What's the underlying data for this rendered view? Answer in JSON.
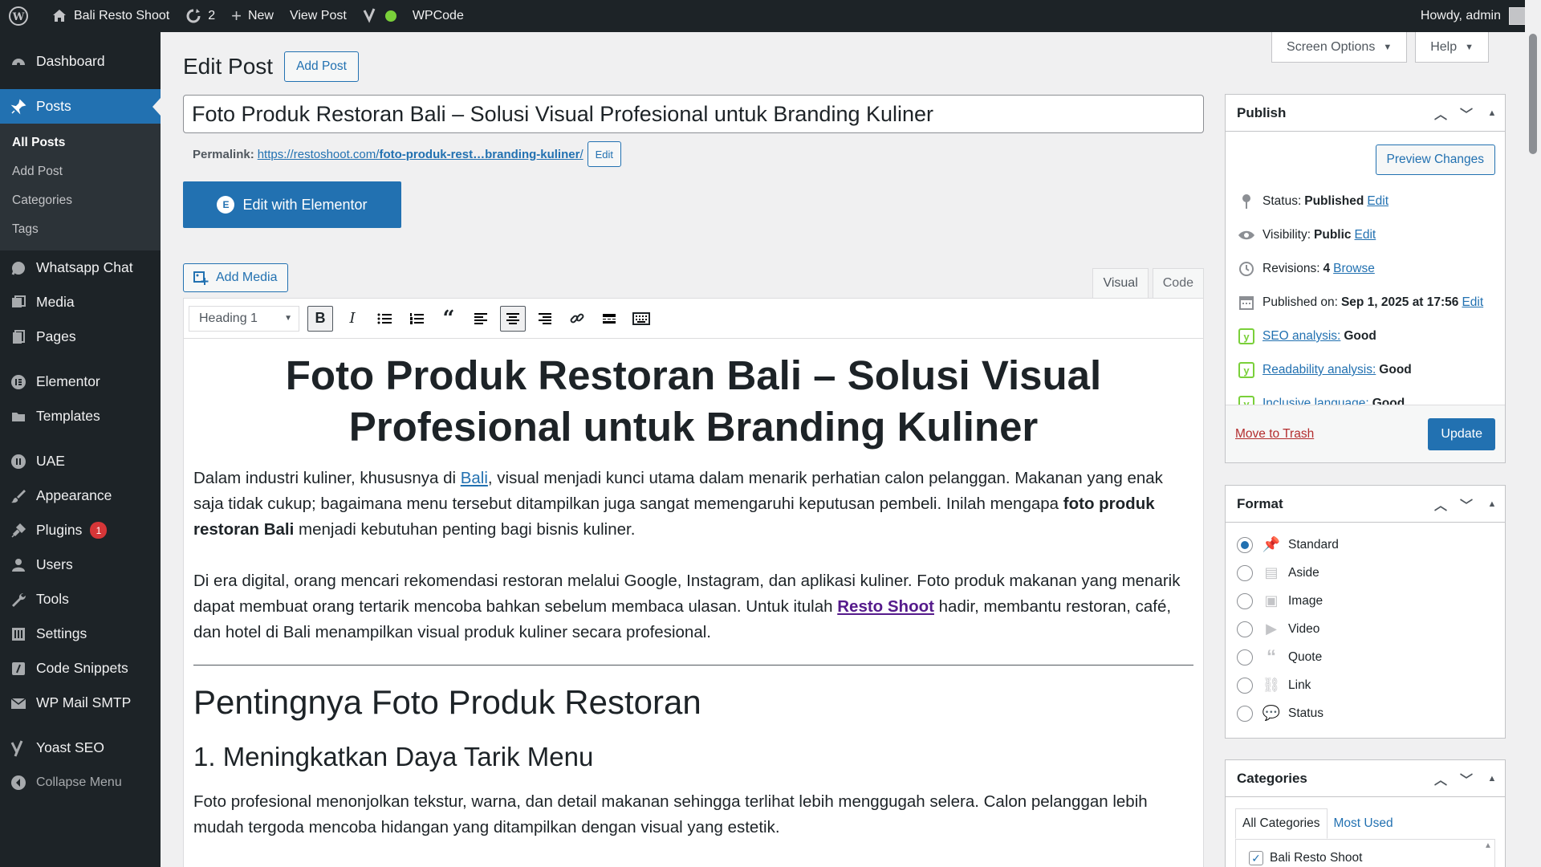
{
  "adminbar": {
    "site_name": "Bali Resto Shoot",
    "updates_count": "2",
    "new_label": "New",
    "view_post": "View Post",
    "wpcode": "WPCode",
    "greeting": "Howdy, admin"
  },
  "sidebar": {
    "dashboard": "Dashboard",
    "posts": "Posts",
    "sub": [
      "All Posts",
      "Add Post",
      "Categories",
      "Tags"
    ],
    "whatsapp": "Whatsapp Chat",
    "media": "Media",
    "pages": "Pages",
    "elementor": "Elementor",
    "templates": "Templates",
    "uae": "UAE",
    "appearance": "Appearance",
    "plugins": "Plugins",
    "plugins_badge": "1",
    "users": "Users",
    "tools": "Tools",
    "settings": "Settings",
    "code_snippets": "Code Snippets",
    "wp_mail": "WP Mail SMTP",
    "yoast": "Yoast SEO",
    "collapse": "Collapse Menu"
  },
  "screen_options": "Screen Options",
  "help": "Help",
  "page_title": "Edit Post",
  "add_post": "Add Post",
  "post_title": "Foto Produk Restoran Bali – Solusi Visual Profesional untuk Branding Kuliner",
  "permalink": {
    "label": "Permalink:",
    "url_base": "https://restoshoot.com/",
    "url_slug": "foto-produk-rest…branding-kuliner",
    "url_end": "/",
    "edit": "Edit"
  },
  "elementor_button": "Edit with Elementor",
  "add_media": "Add Media",
  "editor_tabs": {
    "visual": "Visual",
    "code": "Code"
  },
  "toolbar": {
    "format": "Heading 1"
  },
  "content": {
    "h1": "Foto Produk Restoran Bali – Solusi Visual Profesional untuk Branding Kuliner",
    "p1_a": "Dalam industri kuliner, khususnya di ",
    "p1_link": "Bali",
    "p1_b": ", visual menjadi kunci utama dalam menarik perhatian calon pelanggan. Makanan yang enak saja tidak cukup; bagaimana menu tersebut ditampilkan juga sangat memengaruhi keputusan pembeli. Inilah mengapa ",
    "p1_bold": "foto produk restoran Bali",
    "p1_c": " menjadi kebutuhan penting bagi bisnis kuliner.",
    "p2_a": "Di era digital, orang mencari rekomendasi restoran melalui Google, Instagram, dan aplikasi kuliner. Foto produk makanan yang menarik dapat membuat orang tertarik mencoba bahkan sebelum membaca ulasan. Untuk itulah ",
    "p2_link": "Resto Shoot",
    "p2_b": " hadir, membantu restoran, café, dan hotel di Bali menampilkan visual produk kuliner secara profesional.",
    "h2": "Pentingnya Foto Produk Restoran",
    "h3": "1. Meningkatkan Daya Tarik Menu",
    "p3": "Foto profesional menonjolkan tekstur, warna, dan detail makanan sehingga terlihat lebih menggugah selera. Calon pelanggan lebih mudah tergoda mencoba hidangan yang ditampilkan dengan visual yang estetik."
  },
  "publish": {
    "title": "Publish",
    "preview": "Preview Changes",
    "status_label": "Status:",
    "status_value": "Published",
    "visibility_label": "Visibility:",
    "visibility_value": "Public",
    "revisions_label": "Revisions:",
    "revisions_value": "4",
    "browse": "Browse",
    "published_label": "Published on:",
    "published_value": "Sep 1, 2025 at 17:56",
    "edit": "Edit",
    "seo_link": "SEO analysis:",
    "seo_value": "Good",
    "read_link": "Readability analysis:",
    "read_value": "Good",
    "incl_link": "Inclusive language:",
    "incl_value": "Good",
    "trash": "Move to Trash",
    "update": "Update"
  },
  "format_box": {
    "title": "Format",
    "options": [
      "Standard",
      "Aside",
      "Image",
      "Video",
      "Quote",
      "Link",
      "Status"
    ]
  },
  "categories_box": {
    "title": "Categories",
    "tab_all": "All Categories",
    "tab_used": "Most Used",
    "item": "Bali Resto Shoot"
  }
}
